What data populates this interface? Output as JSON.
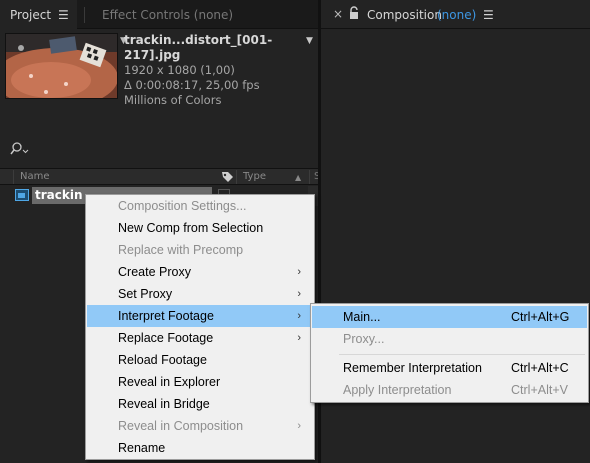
{
  "project_panel": {
    "tab_label": "Project",
    "effect_controls_label": "Effect Controls (none)",
    "file_info": {
      "name": "trackin...distort_[001-217].jpg",
      "resolution": "1920 x 1080 (1,00)",
      "duration": "Δ 0:00:08:17, 25,00 fps",
      "colors": "Millions of Colors"
    },
    "columns": {
      "name": "Name",
      "type": "Type",
      "extra": "S"
    },
    "selected_item": "trackin"
  },
  "composition_panel": {
    "title": "Composition",
    "value": "(none)"
  },
  "context_menu": {
    "items": [
      {
        "label": "Composition Settings...",
        "disabled": true
      },
      {
        "label": "New Comp from Selection"
      },
      {
        "label": "Replace with Precomp",
        "disabled": true
      },
      {
        "label": "Create Proxy",
        "submenu": true
      },
      {
        "label": "Set Proxy",
        "submenu": true
      },
      {
        "label": "Interpret Footage",
        "submenu": true,
        "highlighted": true
      },
      {
        "label": "Replace Footage",
        "submenu": true
      },
      {
        "label": "Reload Footage"
      },
      {
        "label": "Reveal in Explorer"
      },
      {
        "label": "Reveal in Bridge"
      },
      {
        "label": "Reveal in Composition",
        "submenu": true,
        "disabled": true
      },
      {
        "label": "Rename"
      }
    ]
  },
  "submenu": {
    "items": [
      {
        "label": "Main...",
        "shortcut": "Ctrl+Alt+G",
        "highlighted": true
      },
      {
        "label": "Proxy...",
        "disabled": true
      },
      {
        "label": "Remember Interpretation",
        "shortcut": "Ctrl+Alt+C"
      },
      {
        "label": "Apply Interpretation",
        "shortcut": "Ctrl+Alt+V",
        "disabled": true
      }
    ]
  },
  "colors": {
    "highlight": "#91c9f7",
    "accent_blue": "#3d97e3",
    "panel_bg": "#232323"
  }
}
